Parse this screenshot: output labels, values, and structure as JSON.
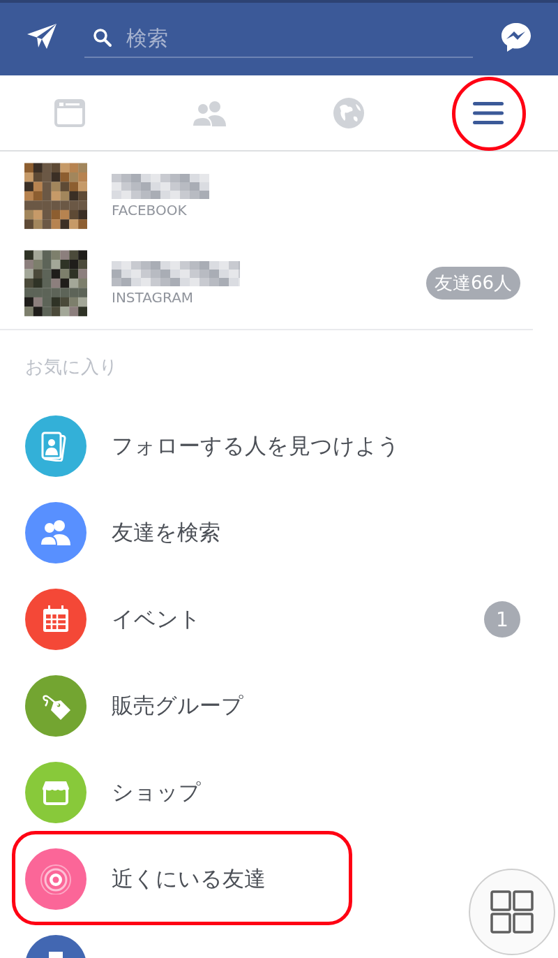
{
  "search": {
    "placeholder": "検索"
  },
  "tabs": [
    {
      "kind": "feed",
      "selected": false,
      "annotated": false
    },
    {
      "kind": "friends",
      "selected": false,
      "annotated": false
    },
    {
      "kind": "globe",
      "selected": false,
      "annotated": false
    },
    {
      "kind": "menu",
      "selected": true,
      "annotated": true
    }
  ],
  "accounts": [
    {
      "service": "FACEBOOK"
    },
    {
      "service": "INSTAGRAM",
      "badge": "友達66人"
    }
  ],
  "favorites": {
    "heading": "お気に入り",
    "items": [
      {
        "kind": "follow",
        "color": "#33b0d8",
        "label": "フォローする人を見つけよう",
        "annotated": false
      },
      {
        "kind": "find-friends",
        "color": "#5890ff",
        "label": "友達を検索",
        "annotated": false
      },
      {
        "kind": "events",
        "color": "#f44837",
        "label": "イベント",
        "badge": "1",
        "annotated": false
      },
      {
        "kind": "sale-groups",
        "color": "#73a531",
        "label": "販売グループ",
        "annotated": false
      },
      {
        "kind": "shop",
        "color": "#88c93a",
        "label": "ショップ",
        "annotated": false
      },
      {
        "kind": "nearby",
        "color": "#fb6698",
        "label": "近くにいる友達",
        "annotated": true
      },
      {
        "kind": "saved",
        "color": "#4267b2",
        "annotated": false
      }
    ]
  }
}
